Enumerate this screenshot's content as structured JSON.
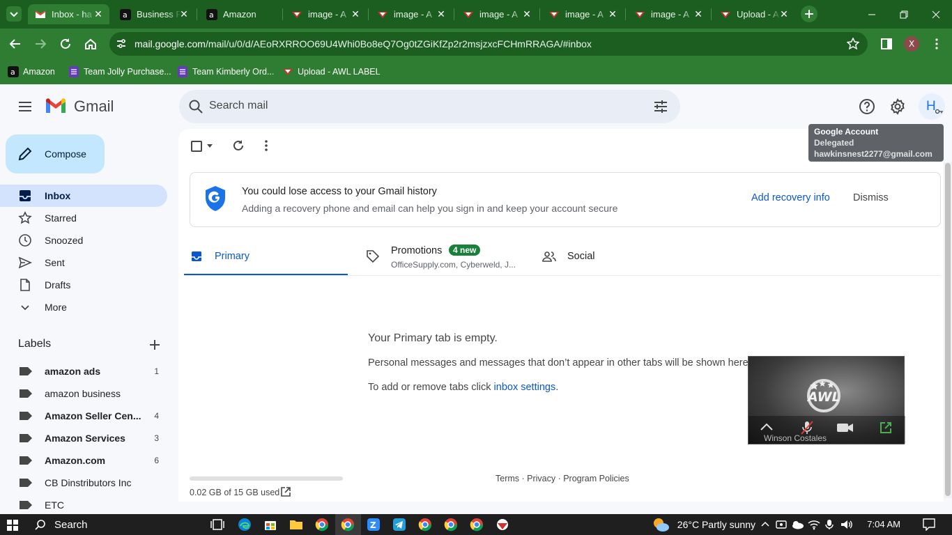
{
  "browser": {
    "tabs": [
      {
        "label": "Inbox - ha",
        "icon": "gmail-icon",
        "active": true
      },
      {
        "label": "Business P",
        "icon": "amazon-icon"
      },
      {
        "label": "Amazon",
        "icon": "amazon-icon"
      },
      {
        "label": "image - A",
        "icon": "awl-icon"
      },
      {
        "label": "image - A",
        "icon": "awl-icon"
      },
      {
        "label": "image - A",
        "icon": "awl-icon"
      },
      {
        "label": "image - A",
        "icon": "awl-icon"
      },
      {
        "label": "image - A",
        "icon": "awl-icon"
      },
      {
        "label": "Upload - A",
        "icon": "awl-icon"
      }
    ],
    "url_host": "mail.google.com",
    "url_path": "/mail/u/0/d/AEoRXRROO69U4Whi0Bo8eQ7Og0tZGiKfZp2r2msjzxcFCHmRRAGA/#inbox",
    "profile_initial": "X",
    "bookmarks": [
      {
        "label": "Amazon",
        "icon": "amazon-icon"
      },
      {
        "label": "Team Jolly Purchase...",
        "icon": "form-icon"
      },
      {
        "label": "Team Kimberly Ord...",
        "icon": "form-icon"
      },
      {
        "label": "Upload - AWL LABEL",
        "icon": "awl-icon"
      }
    ],
    "colors": {
      "frame": "#1b5e20",
      "toolbar": "#2e7d32"
    }
  },
  "gmail": {
    "logo_text": "Gmail",
    "search_placeholder": "Search mail",
    "avatar_initial": "H",
    "compose_label": "Compose",
    "nav": [
      {
        "label": "Inbox",
        "icon": "inbox-icon",
        "active": true
      },
      {
        "label": "Starred",
        "icon": "star-icon"
      },
      {
        "label": "Snoozed",
        "icon": "clock-icon"
      },
      {
        "label": "Sent",
        "icon": "send-icon"
      },
      {
        "label": "Drafts",
        "icon": "draft-icon"
      },
      {
        "label": "More",
        "icon": "chevron-down-icon"
      }
    ],
    "labels_heading": "Labels",
    "labels": [
      {
        "label": "amazon ads",
        "count": "1",
        "bold": true
      },
      {
        "label": "amazon business",
        "count": "",
        "bold": false
      },
      {
        "label": "Amazon Seller Cen...",
        "count": "4",
        "bold": true
      },
      {
        "label": "Amazon Services",
        "count": "3",
        "bold": true
      },
      {
        "label": "Amazon.com",
        "count": "6",
        "bold": true
      },
      {
        "label": "CB Dinstributors Inc",
        "count": "",
        "bold": false
      },
      {
        "label": "ETC",
        "count": "",
        "bold": false
      }
    ],
    "banner": {
      "title": "You could lose access to your Gmail history",
      "subtitle": "Adding a recovery phone and email can help you sign in and keep your account secure",
      "primary_action": "Add recovery info",
      "secondary_action": "Dismiss"
    },
    "tabs": {
      "primary": "Primary",
      "promotions": "Promotions",
      "promotions_badge": "4 new",
      "promotions_snippet": "OfficeSupply.com, Cyberweld, J...",
      "social": "Social"
    },
    "empty": {
      "title": "Your Primary tab is empty.",
      "message": "Personal messages and messages that don’t appear in other tabs will be shown here.",
      "hint_prefix": "To add or remove tabs click ",
      "hint_link": "inbox settings",
      "hint_suffix": "."
    },
    "storage": {
      "text": "0.02 GB of 15 GB used",
      "fraction": 0.0013
    },
    "footer": "Terms · Privacy · Program Policies",
    "tooltip": {
      "title": "Google Account",
      "status": "Delegated",
      "email": "hawkinsnest2277@gmail.com"
    },
    "video": {
      "name": "Winson Costales",
      "logo": "AWL"
    }
  },
  "taskbar": {
    "search_label": "Search",
    "weather": "26°C  Partly sunny",
    "time": "7:04 AM"
  }
}
